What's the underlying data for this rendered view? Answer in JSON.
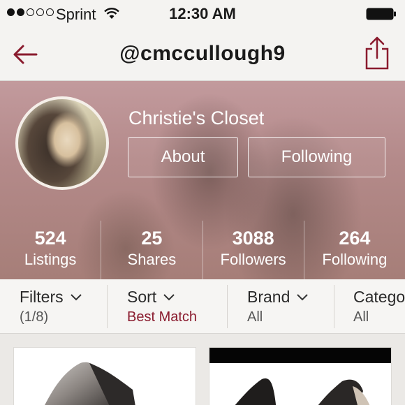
{
  "status_bar": {
    "carrier": "Sprint",
    "time": "12:30 AM",
    "signal_icon": "signal-dots-icon",
    "wifi_icon": "wifi-icon",
    "battery_icon": "battery-icon"
  },
  "nav": {
    "title": "@cmccullough9",
    "back_icon": "back-arrow-icon",
    "share_icon": "share-icon",
    "accent_color": "#8a1b2e"
  },
  "profile": {
    "closet_name": "Christie's Closet",
    "about_label": "About",
    "following_label": "Following",
    "stats": [
      {
        "value": "524",
        "label": "Listings"
      },
      {
        "value": "25",
        "label": "Shares"
      },
      {
        "value": "3088",
        "label": "Followers"
      },
      {
        "value": "264",
        "label": "Following"
      }
    ]
  },
  "filters": [
    {
      "title": "Filters",
      "value": "(1/8)"
    },
    {
      "title": "Sort",
      "value": "Best Match"
    },
    {
      "title": "Brand",
      "value": "All"
    },
    {
      "title": "Catego",
      "value": "All"
    }
  ]
}
